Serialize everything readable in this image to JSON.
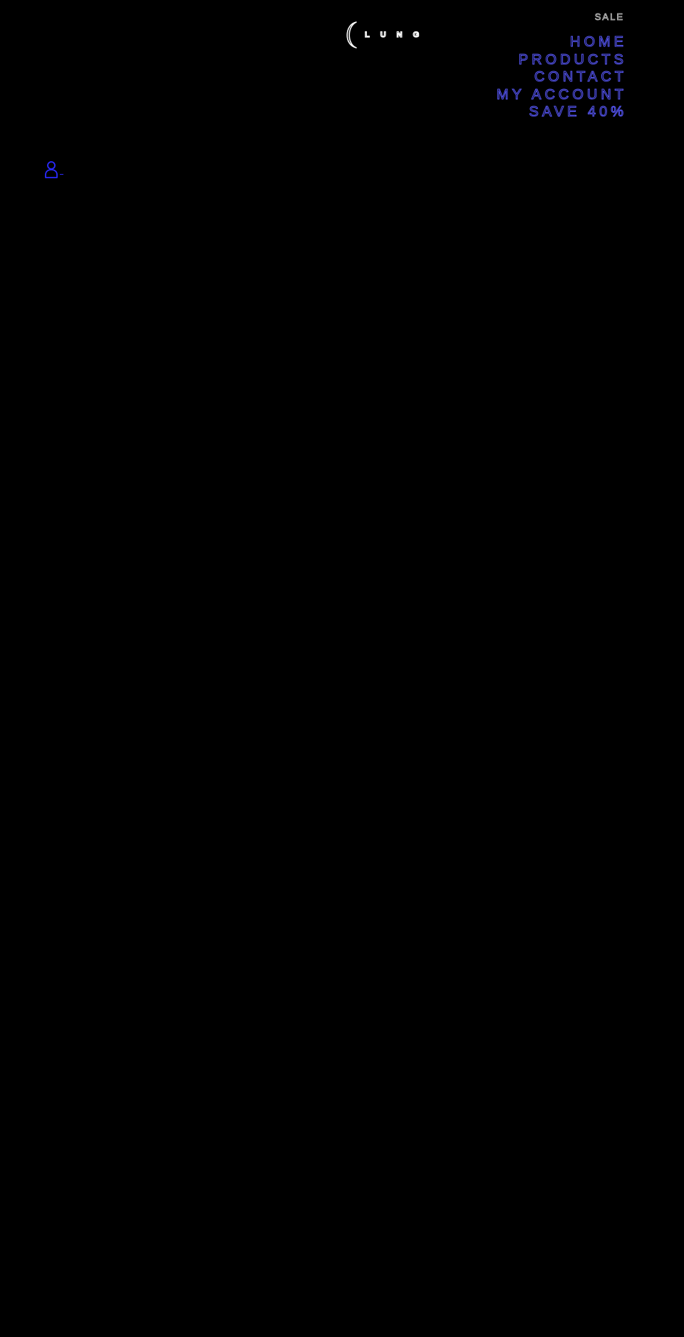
{
  "header": {
    "logo": {
      "wordmark": "LUNG",
      "icon": "crescent-moon-icon"
    },
    "top_link": "SALE",
    "nav": [
      {
        "label": "HOME"
      },
      {
        "label": "PRODUCTS"
      },
      {
        "label": "CONTACT"
      },
      {
        "label": "MY ACCOUNT"
      },
      {
        "label": "SAVE 40%"
      }
    ]
  },
  "account": {
    "icon": "user-icon"
  },
  "colors": {
    "background": "#000000",
    "nav_outline": "#5a5aff",
    "account_icon": "#2a2aff",
    "logo_outline": "#ffffff",
    "top_link_outline": "#c8c8c8"
  }
}
